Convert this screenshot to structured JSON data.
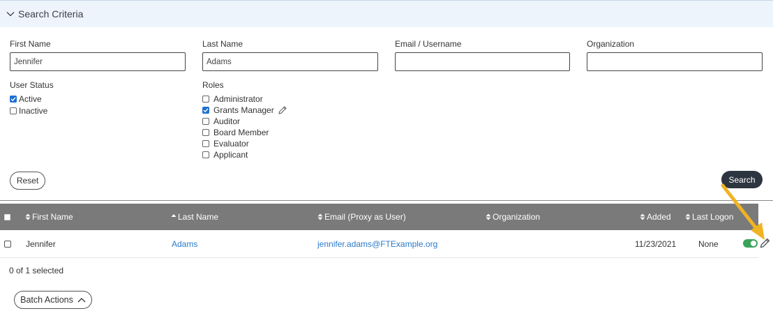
{
  "search_criteria": {
    "title": "Search Criteria",
    "first_name": {
      "label": "First Name",
      "value": "Jennifer",
      "placeholder": ""
    },
    "last_name": {
      "label": "Last Name",
      "value": "Adams",
      "placeholder": ""
    },
    "email": {
      "label": "Email / Username",
      "value": "",
      "placeholder": ""
    },
    "organization": {
      "label": "Organization",
      "value": "",
      "placeholder": ""
    },
    "user_status": {
      "label": "User Status",
      "options": [
        {
          "label": "Active",
          "checked": true
        },
        {
          "label": "Inactive",
          "checked": false
        }
      ]
    },
    "roles": {
      "label": "Roles",
      "options": [
        {
          "label": "Administrator",
          "checked": false
        },
        {
          "label": "Grants Manager",
          "checked": true
        },
        {
          "label": "Auditor",
          "checked": false
        },
        {
          "label": "Board Member",
          "checked": false
        },
        {
          "label": "Evaluator",
          "checked": false
        },
        {
          "label": "Applicant",
          "checked": false
        }
      ]
    },
    "reset_label": "Reset",
    "search_label": "Search"
  },
  "table": {
    "columns": [
      "First Name",
      "Last Name",
      "Email (Proxy as User)",
      "Organization",
      "Added",
      "Last Logon"
    ],
    "rows": [
      {
        "first_name": "Jennifer",
        "last_name": "Adams",
        "email": "jennifer.adams@FTExample.org",
        "organization": "",
        "added": "11/23/2021",
        "last_logon": "None",
        "active": true
      }
    ]
  },
  "selection_status": "0 of 1 selected",
  "batch_actions_label": "Batch Actions",
  "colors": {
    "header_bg": "#eef4fc",
    "table_head_bg": "#7a7a7a",
    "link": "#2a7ac9",
    "checkbox_checked": "#1f6fd0",
    "toggle_on": "#3aa35a",
    "search_button": "#2d3540",
    "annotation_arrow": "#f0b323"
  }
}
